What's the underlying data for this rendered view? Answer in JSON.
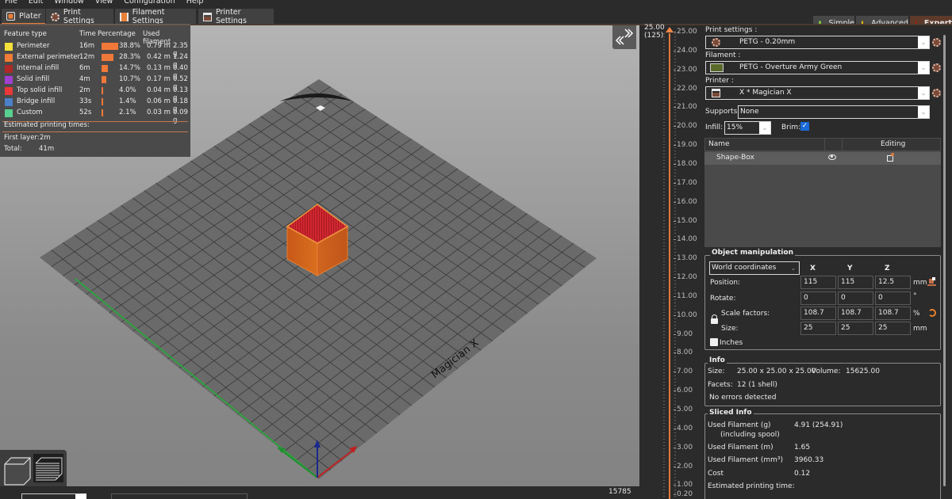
{
  "menu": [
    "File",
    "Edit",
    "Window",
    "View",
    "Configuration",
    "Help"
  ],
  "tabs": [
    {
      "label": "Plater",
      "icon": "plater-icon",
      "active": true
    },
    {
      "label": "Print Settings",
      "icon": "gear-icon",
      "active": false
    },
    {
      "label": "Filament Settings",
      "icon": "filament-spool-icon",
      "active": false
    },
    {
      "label": "Printer Settings",
      "icon": "printer-icon",
      "active": false
    }
  ],
  "modes": [
    {
      "label": "Simple",
      "color": "#7ec63a",
      "active": false
    },
    {
      "label": "Advanced",
      "color": "#f0c800",
      "active": false
    },
    {
      "label": "Expert",
      "color": "#e00000",
      "active": true
    }
  ],
  "legend": {
    "headers": {
      "feature": "Feature type",
      "time": "Time",
      "percentage": "Percentage",
      "filament": "Used filament"
    },
    "rows": [
      {
        "name": "Perimeter",
        "color": "#f5e23a",
        "time": "16m",
        "pct": 38.8,
        "pct_label": "38.8%",
        "length": "0.79 m",
        "weight": "2.35 g"
      },
      {
        "name": "External perimeter",
        "color": "#f07c38",
        "time": "12m",
        "pct": 28.3,
        "pct_label": "28.3%",
        "length": "0.42 m",
        "weight": "1.24 g"
      },
      {
        "name": "Internal infill",
        "color": "#b02828",
        "time": "6m",
        "pct": 14.7,
        "pct_label": "14.7%",
        "length": "0.13 m",
        "weight": "0.40 g"
      },
      {
        "name": "Solid infill",
        "color": "#a040d0",
        "time": "4m",
        "pct": 10.7,
        "pct_label": "10.7%",
        "length": "0.17 m",
        "weight": "0.52 g"
      },
      {
        "name": "Top solid infill",
        "color": "#e83838",
        "time": "2m",
        "pct": 4.0,
        "pct_label": "4.0%",
        "length": "0.04 m",
        "weight": "0.13 g"
      },
      {
        "name": "Bridge infill",
        "color": "#4c80c8",
        "time": "33s",
        "pct": 1.4,
        "pct_label": "1.4%",
        "length": "0.06 m",
        "weight": "0.18 g"
      },
      {
        "name": "Custom",
        "color": "#58d090",
        "time": "52s",
        "pct": 2.1,
        "pct_label": "2.1%",
        "length": "0.03 m",
        "weight": "0.09 g"
      }
    ],
    "estimated_title": "Estimated printing times:",
    "first_layer_label": "First layer:",
    "first_layer_value": "2m",
    "total_label": "Total:",
    "total_value": "41m"
  },
  "viewport": {
    "bed_label": "Magician X",
    "move_count": "15785"
  },
  "slider": {
    "top_value": "25.00",
    "top_layer": "(125)",
    "ticks": [
      "25.00",
      "24.00",
      "23.00",
      "22.00",
      "21.00",
      "20.00",
      "19.00",
      "18.00",
      "17.00",
      "16.00",
      "15.00",
      "14.00",
      "13.00",
      "12.00",
      "11.00",
      "10.00",
      "9.00",
      "8.00",
      "7.00",
      "6.00",
      "5.00",
      "4.00",
      "3.00",
      "2.00",
      "1.00",
      "0.20"
    ]
  },
  "sidebar": {
    "print_settings_label": "Print settings :",
    "print_settings_value": "PETG - 0.20mm",
    "filament_label": "Filament :",
    "filament_value": "PETG - Overture Army Green",
    "filament_color": "#5a6a2a",
    "printer_label": "Printer :",
    "printer_value": "X * Magician X",
    "supports_label": "Supports:",
    "supports_value": "None",
    "infill_label": "Infill:",
    "infill_value": "15%",
    "brim_label": "Brim:",
    "brim_checked": true,
    "objects": {
      "col_name": "Name",
      "col_editing": "Editing",
      "rows": [
        {
          "name": "Shape-Box"
        }
      ]
    },
    "manipulation": {
      "title": "Object manipulation",
      "coord_system": "World coordinates",
      "axes": [
        "X",
        "Y",
        "Z"
      ],
      "position_label": "Position:",
      "position": [
        "115",
        "115",
        "12.5"
      ],
      "position_unit": "mm",
      "rotate_label": "Rotate:",
      "rotate": [
        "0",
        "0",
        "0"
      ],
      "rotate_unit": "°",
      "scale_label": "Scale factors:",
      "scale": [
        "108.7",
        "108.7",
        "108.7"
      ],
      "scale_unit": "%",
      "size_label": "Size:",
      "size": [
        "25",
        "25",
        "25"
      ],
      "size_unit": "mm",
      "inches_label": "Inches",
      "inches_checked": false
    },
    "info": {
      "title": "Info",
      "size_label": "Size:",
      "size_value": "25.00 x 25.00 x 25.00",
      "volume_label": "Volume:",
      "volume_value": "15625.00",
      "facets_label": "Facets:",
      "facets_value": "12 (1 shell)",
      "errors": "No errors detected"
    },
    "sliced": {
      "title": "Sliced Info",
      "used_g_label": "Used Filament (g)",
      "used_g_sub": "(including spool)",
      "used_g_value": "4.91 (254.91)",
      "used_m_label": "Used Filament (m)",
      "used_m_value": "1.65",
      "used_mm3_label": "Used Filament (mm³)",
      "used_mm3_value": "3960.33",
      "cost_label": "Cost",
      "cost_value": "0.12",
      "time_label": "Estimated printing time:"
    }
  }
}
